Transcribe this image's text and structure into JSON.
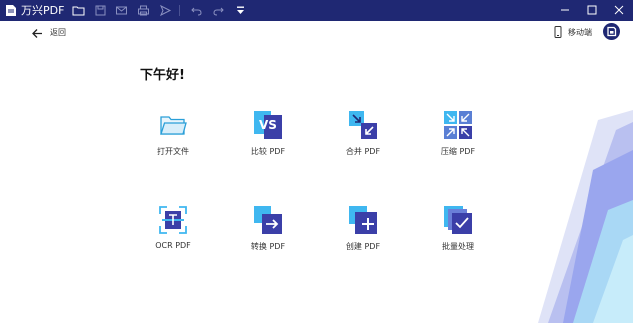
{
  "app": {
    "title": "万兴PDF"
  },
  "toolbar": {
    "icons": [
      "open-folder-icon",
      "save-icon",
      "mail-icon",
      "print-icon",
      "share-icon",
      "undo-icon",
      "redo-icon",
      "dropdown-icon"
    ]
  },
  "header": {
    "back_label": "返回",
    "mobile_label": "移动端"
  },
  "main": {
    "greeting": "下午好!",
    "tools": [
      {
        "label": "打开文件",
        "icon": "open-folder-icon"
      },
      {
        "label": "比较 PDF",
        "icon": "compare-icon"
      },
      {
        "label": "合并 PDF",
        "icon": "merge-icon"
      },
      {
        "label": "压缩 PDF",
        "icon": "compress-icon"
      },
      {
        "label": "OCR PDF",
        "icon": "ocr-icon"
      },
      {
        "label": "转换 PDF",
        "icon": "convert-icon"
      },
      {
        "label": "创建 PDF",
        "icon": "create-icon"
      },
      {
        "label": "批量处理",
        "icon": "batch-icon"
      }
    ]
  },
  "colors": {
    "titlebar": "#1f2873",
    "accent": "#3b3fa8",
    "accent_light": "#3fb7f0"
  }
}
